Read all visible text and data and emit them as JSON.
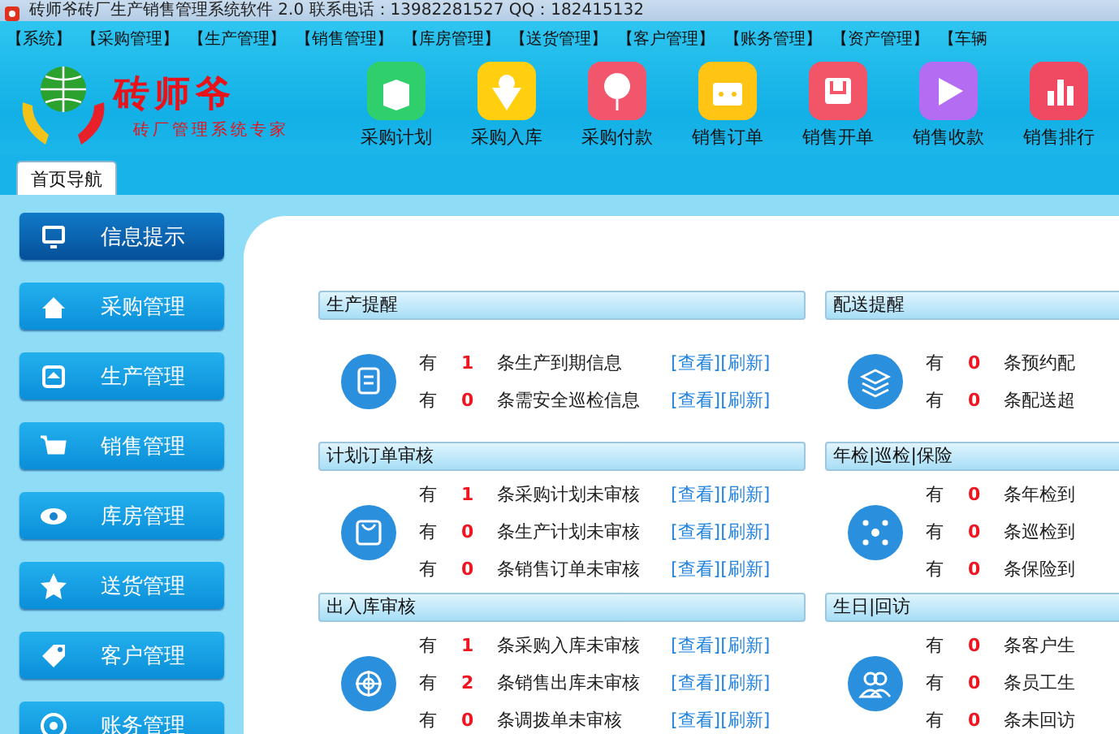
{
  "window": {
    "title": "砖师爷砖厂生产销售管理系统软件 2.0 联系电话：13982281527 QQ：182415132"
  },
  "menu": [
    "【系统】",
    "【采购管理】",
    "【生产管理】",
    "【销售管理】",
    "【库房管理】",
    "【送货管理】",
    "【客户管理】",
    "【账务管理】",
    "【资产管理】",
    "【车辆"
  ],
  "logo": {
    "name": "砖师爷",
    "slogan": "砖厂管理系统专家"
  },
  "toolbar": [
    "采购计划",
    "采购入库",
    "采购付款",
    "销售订单",
    "销售开单",
    "销售收款",
    "销售排行"
  ],
  "tabs": [
    {
      "label": "首页导航",
      "selected": true
    }
  ],
  "sidebar": {
    "items": [
      {
        "label": "信息提示",
        "selected": true
      },
      {
        "label": "采购管理",
        "selected": false
      },
      {
        "label": "生产管理",
        "selected": false
      },
      {
        "label": "销售管理",
        "selected": false
      },
      {
        "label": "库房管理",
        "selected": false
      },
      {
        "label": "送货管理",
        "selected": false
      },
      {
        "label": "客户管理",
        "selected": false
      },
      {
        "label": "账务管理",
        "selected": false
      }
    ]
  },
  "columns": [
    [
      {
        "title": "生产提醒",
        "rows": [
          {
            "prefix": "有",
            "count": "1",
            "text": "条生产到期信息",
            "links": [
              "[查看]",
              "[刷新]"
            ]
          },
          {
            "prefix": "有",
            "count": "0",
            "text": "条需安全巡检信息",
            "links": [
              "[查看]",
              "[刷新]"
            ]
          }
        ]
      },
      {
        "title": "计划订单审核",
        "rows": [
          {
            "prefix": "有",
            "count": "1",
            "text": "条采购计划未审核",
            "links": [
              "[查看]",
              "[刷新]"
            ]
          },
          {
            "prefix": "有",
            "count": "0",
            "text": "条生产计划未审核",
            "links": [
              "[查看]",
              "[刷新]"
            ]
          },
          {
            "prefix": "有",
            "count": "0",
            "text": "条销售订单未审核",
            "links": [
              "[查看]",
              "[刷新]"
            ]
          }
        ]
      },
      {
        "title": "出入库审核",
        "rows": [
          {
            "prefix": "有",
            "count": "1",
            "text": "条采购入库未审核",
            "links": [
              "[查看]",
              "[刷新]"
            ]
          },
          {
            "prefix": "有",
            "count": "2",
            "text": "条销售出库未审核",
            "links": [
              "[查看]",
              "[刷新]"
            ]
          },
          {
            "prefix": "有",
            "count": "0",
            "text": "条调拨单未审核",
            "links": [
              "[查看]",
              "[刷新]"
            ]
          }
        ]
      }
    ],
    [
      {
        "title": "配送提醒",
        "rows": [
          {
            "prefix": "有",
            "count": "0",
            "text": "条预约配"
          },
          {
            "prefix": "有",
            "count": "0",
            "text": "条配送超"
          }
        ]
      },
      {
        "title": "年检|巡检|保险",
        "rows": [
          {
            "prefix": "有",
            "count": "0",
            "text": "条年检到"
          },
          {
            "prefix": "有",
            "count": "0",
            "text": "条巡检到"
          },
          {
            "prefix": "有",
            "count": "0",
            "text": "条保险到"
          }
        ]
      },
      {
        "title": "生日|回访",
        "rows": [
          {
            "prefix": "有",
            "count": "0",
            "text": "条客户生"
          },
          {
            "prefix": "有",
            "count": "0",
            "text": "条员工生"
          },
          {
            "prefix": "有",
            "count": "0",
            "text": "条未回访"
          }
        ]
      }
    ]
  ]
}
